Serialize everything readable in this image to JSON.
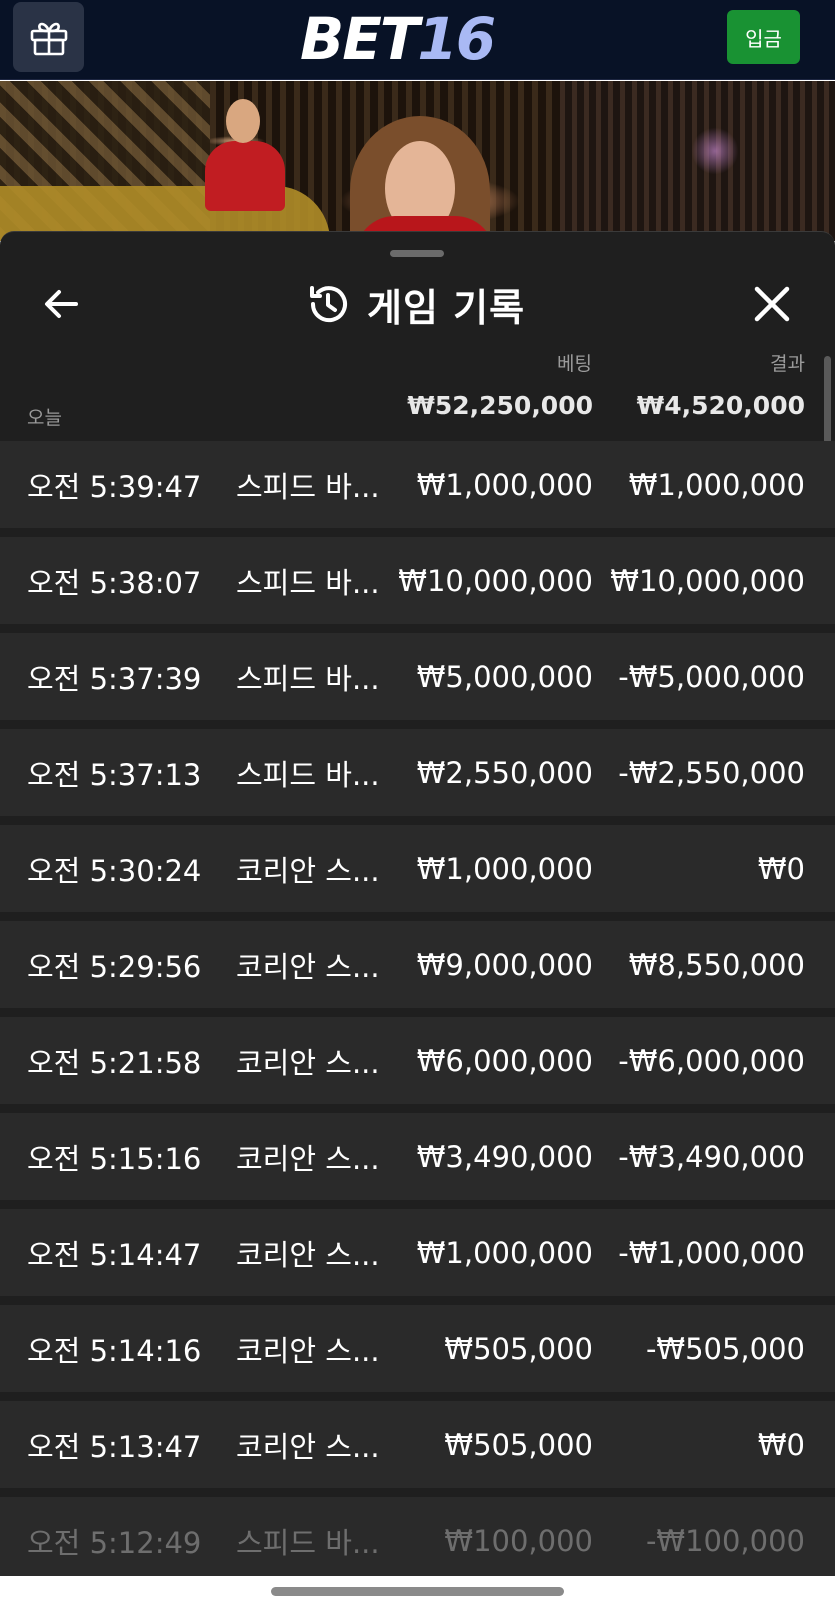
{
  "header": {
    "logo_white": "BET",
    "logo_blue": "16",
    "deposit_label": "입금",
    "gift_icon": "gift-icon"
  },
  "panel": {
    "title": "게임 기록",
    "title_icon": "history-icon",
    "back_icon": "arrow-left-icon",
    "close_icon": "close-icon"
  },
  "summary": {
    "bet_label": "베팅",
    "result_label": "결과",
    "day_label": "오늘",
    "bet_total": "₩52,250,000",
    "result_total": "₩4,520,000"
  },
  "rows": [
    {
      "time": "오전 5:39:47",
      "game": "스피드 바...",
      "bet": "₩1,000,000",
      "result": "₩1,000,000"
    },
    {
      "time": "오전 5:38:07",
      "game": "스피드 바...",
      "bet": "₩10,000,000",
      "result": "₩10,000,000"
    },
    {
      "time": "오전 5:37:39",
      "game": "스피드 바...",
      "bet": "₩5,000,000",
      "result": "-₩5,000,000"
    },
    {
      "time": "오전 5:37:13",
      "game": "스피드 바...",
      "bet": "₩2,550,000",
      "result": "-₩2,550,000"
    },
    {
      "time": "오전 5:30:24",
      "game": "코리안 스...",
      "bet": "₩1,000,000",
      "result": "₩0"
    },
    {
      "time": "오전 5:29:56",
      "game": "코리안 스...",
      "bet": "₩9,000,000",
      "result": "₩8,550,000"
    },
    {
      "time": "오전 5:21:58",
      "game": "코리안 스...",
      "bet": "₩6,000,000",
      "result": "-₩6,000,000"
    },
    {
      "time": "오전 5:15:16",
      "game": "코리안 스...",
      "bet": "₩3,490,000",
      "result": "-₩3,490,000"
    },
    {
      "time": "오전 5:14:47",
      "game": "코리안 스...",
      "bet": "₩1,000,000",
      "result": "-₩1,000,000"
    },
    {
      "time": "오전 5:14:16",
      "game": "코리안 스...",
      "bet": "₩505,000",
      "result": "-₩505,000"
    },
    {
      "time": "오전 5:13:47",
      "game": "코리안 스...",
      "bet": "₩505,000",
      "result": "₩0"
    },
    {
      "time": "오전 5:12:49",
      "game": "스피드 바...",
      "bet": "₩100,000",
      "result": "-₩100,000"
    }
  ],
  "colors": {
    "topbar": "#081226",
    "deposit": "#199233",
    "sheet": "#1f1f1f",
    "row": "#2a2a2a",
    "logo_accent": "#a9b9f4"
  }
}
